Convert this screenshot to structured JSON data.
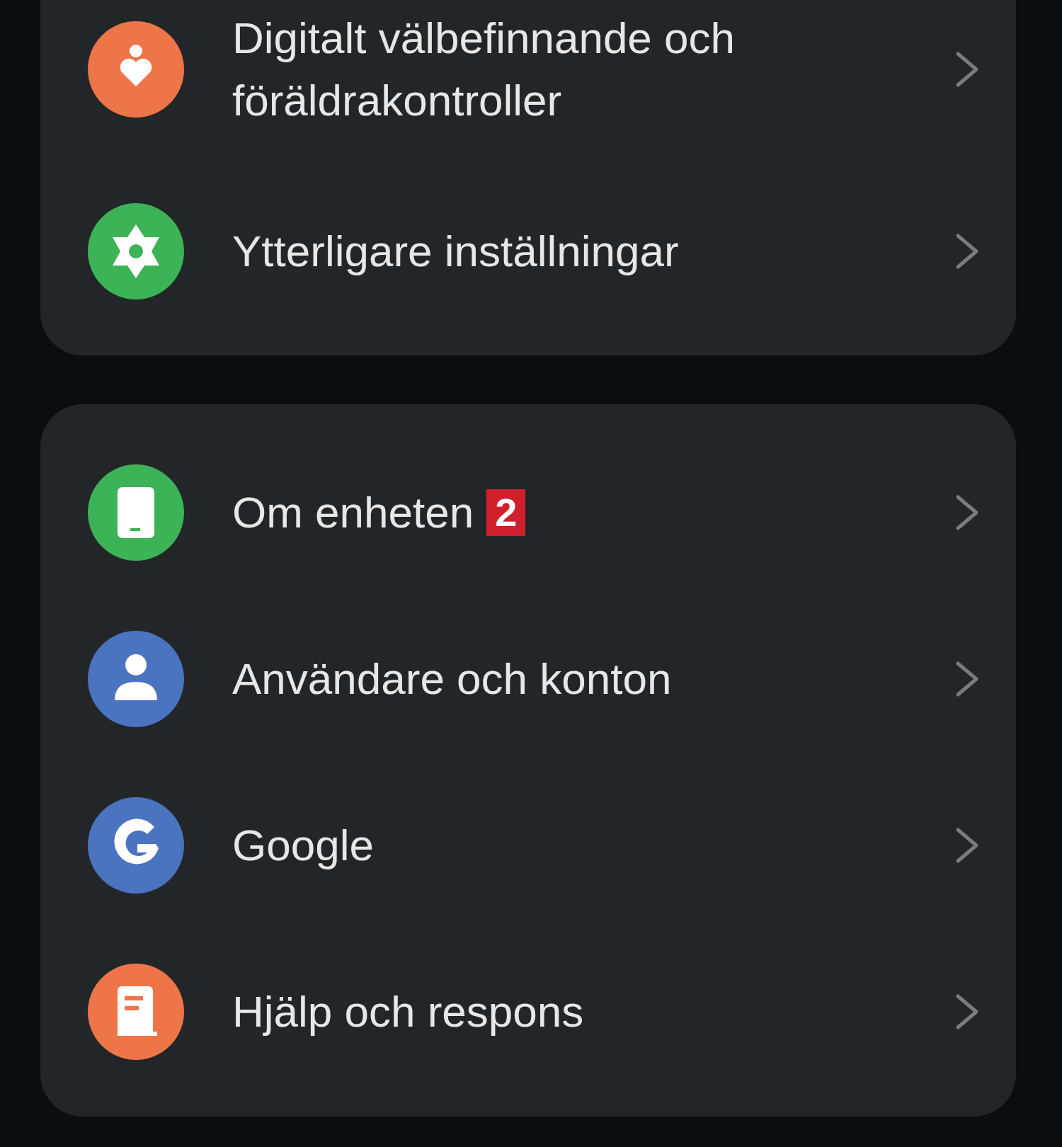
{
  "groups": [
    {
      "items": [
        {
          "label": "Digitalt välbefinnande och föräldrakontroller",
          "kind": "wellbeing",
          "color": "#ee7548"
        },
        {
          "label": "Ytterligare inställningar",
          "kind": "gear",
          "color": "#3cb356"
        }
      ]
    },
    {
      "items": [
        {
          "label": "Om enheten",
          "kind": "phone",
          "color": "#3cb356",
          "badge": "2"
        },
        {
          "label": "Användare och konton",
          "kind": "person",
          "color": "#4a73c0"
        },
        {
          "label": "Google",
          "kind": "google",
          "color": "#4a73c0"
        },
        {
          "label": "Hjälp och respons",
          "kind": "book",
          "color": "#ee7548"
        }
      ]
    }
  ]
}
